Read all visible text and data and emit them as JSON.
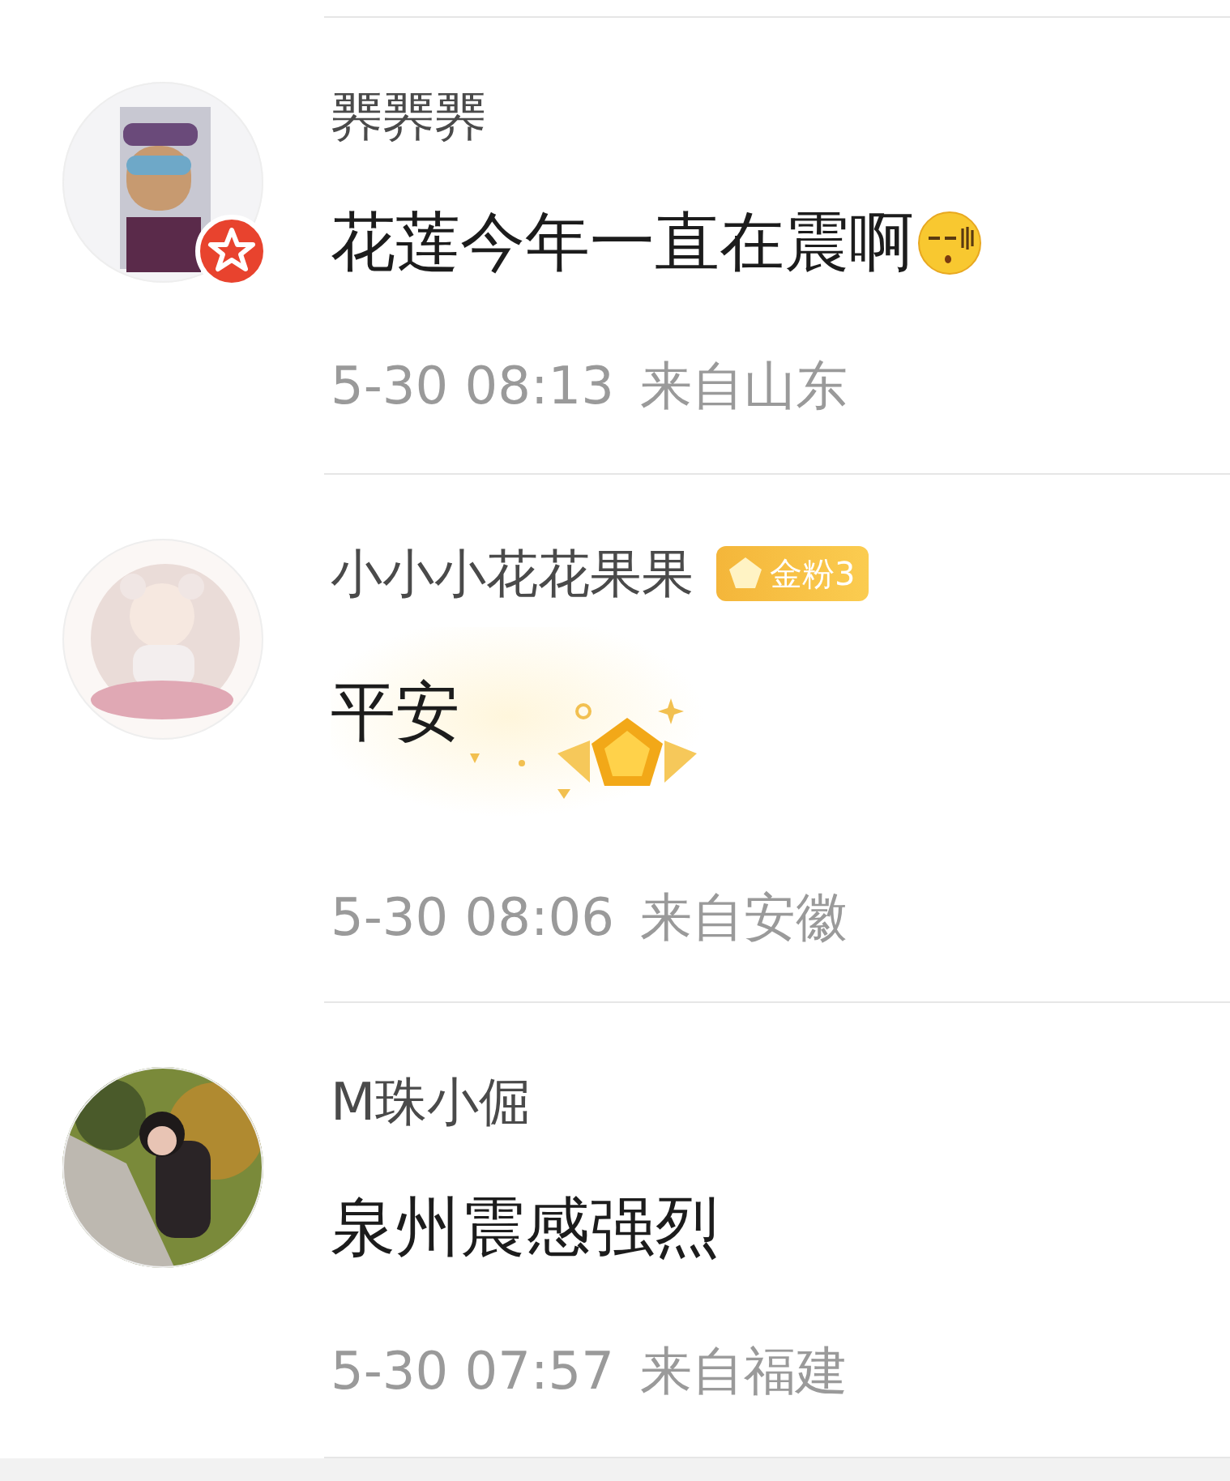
{
  "comments": [
    {
      "user": "臩臩臩",
      "verified": true,
      "text": "花莲今年一直在震啊",
      "emoji": true,
      "time": "5-30 08:13",
      "location": "来自山东"
    },
    {
      "user": "小小小花花果果",
      "fan_badge": "金粉3",
      "text": "平安",
      "sticker": true,
      "time": "5-30 08:06",
      "location": "来自安徽"
    },
    {
      "user": "M珠小倔",
      "text": "泉州震感强烈",
      "time": "5-30 07:57",
      "location": "来自福建"
    }
  ]
}
